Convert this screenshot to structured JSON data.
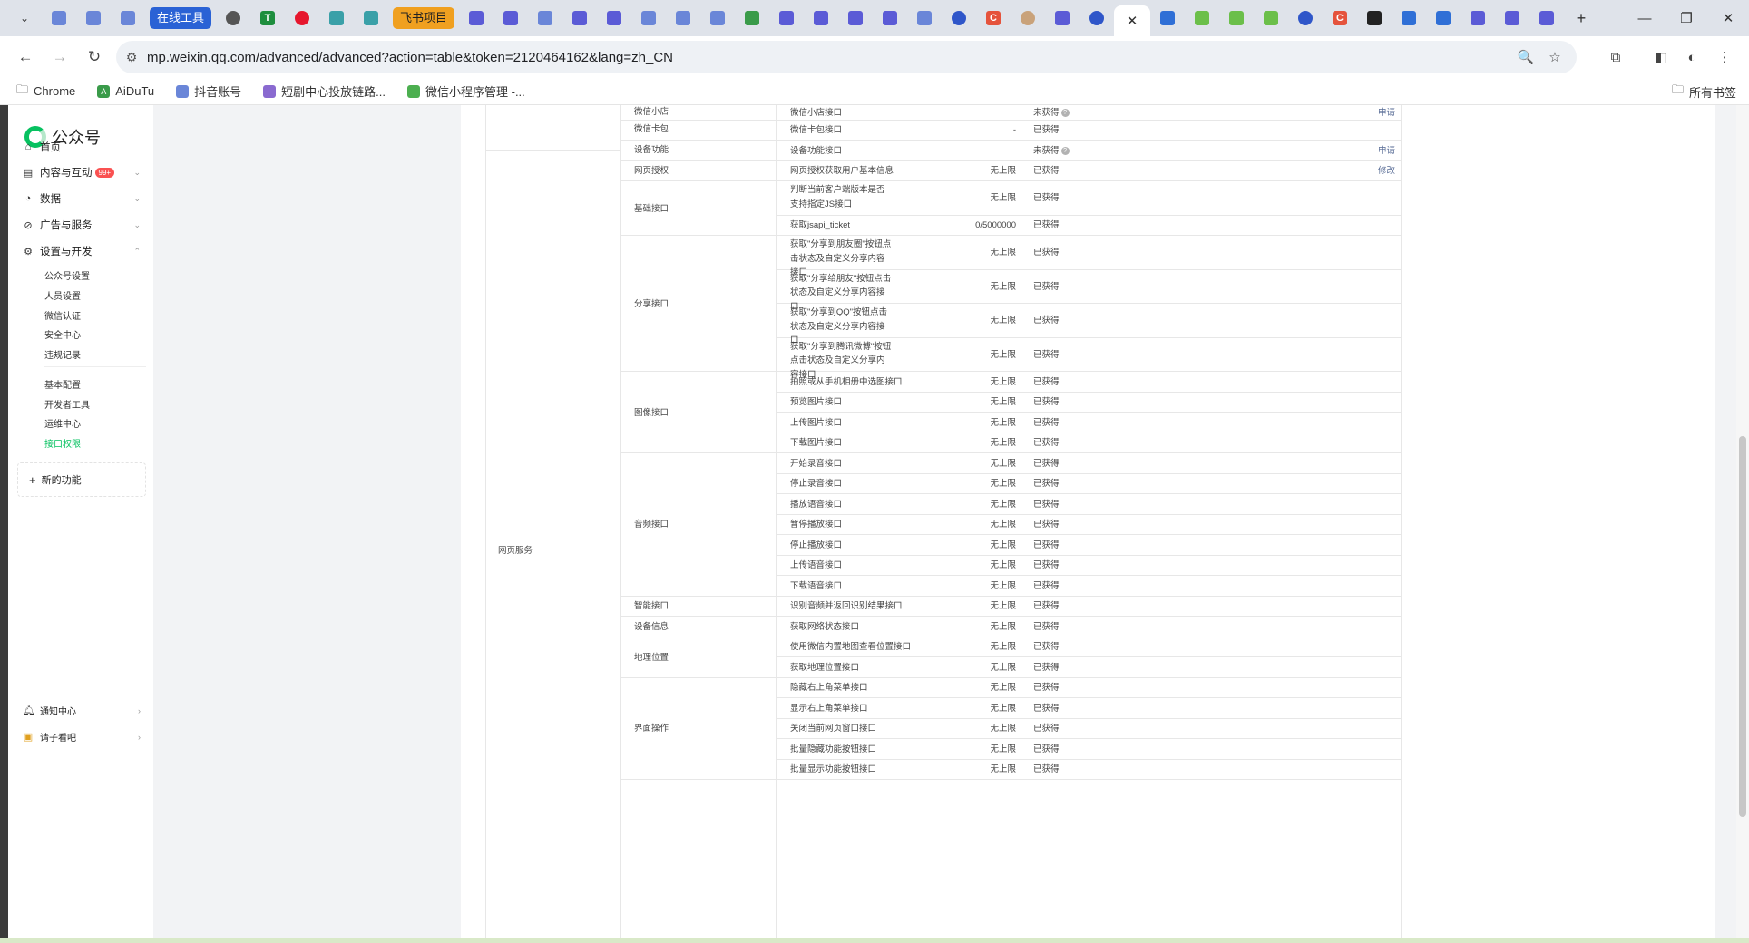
{
  "browser": {
    "tabs": {
      "pill_online_tools": "在线工具",
      "pill_feishu_project": "飞书项目",
      "new_tab_symbol": "+",
      "close_symbol": "✕"
    },
    "window": {
      "minimize": "—",
      "maximize": "❐",
      "close": "✕"
    },
    "url": "mp.weixin.qq.com/advanced/advanced?action=table&token=2120464162&lang=zh_CN",
    "bookmarks": [
      "Chrome",
      "AiDuTu",
      "抖音账号",
      "短剧中心投放链路...",
      "微信小程序管理 -..."
    ],
    "all_bookmarks": "所有书签"
  },
  "sidebar": {
    "brand": "公众号",
    "menu": [
      {
        "label": "首页",
        "icon": "home-icon"
      },
      {
        "label": "内容与互动",
        "icon": "document-icon",
        "badge": "99+"
      },
      {
        "label": "数据",
        "icon": "chart-icon"
      },
      {
        "label": "广告与服务",
        "icon": "compass-icon"
      },
      {
        "label": "设置与开发",
        "icon": "gear-icon"
      }
    ],
    "sub_settings": [
      "公众号设置",
      "人员设置",
      "微信认证",
      "安全中心",
      "违规记录"
    ],
    "sub_dev": [
      "基本配置",
      "开发者工具",
      "运维中心",
      "接口权限"
    ],
    "new_function": "新的功能",
    "bottom": [
      {
        "label": "通知中心",
        "icon": "bell-icon"
      },
      {
        "label": "请子看吧",
        "icon": "tv-icon"
      }
    ]
  },
  "table": {
    "group_label": "网页服务",
    "top_rows": [
      {
        "category": "微信小店",
        "name": "微信小店接口",
        "limit": "",
        "status": "未获得",
        "help": true,
        "op": "申请"
      },
      {
        "category": "微信卡包",
        "name": "微信卡包接口",
        "limit": "-",
        "status": "已获得",
        "help": false,
        "op": ""
      },
      {
        "category": "设备功能",
        "name": "设备功能接口",
        "limit": "",
        "status": "未获得",
        "help": true,
        "op": "申请"
      }
    ],
    "categories": [
      "网页授权",
      "基础接口",
      "分享接口",
      "图像接口",
      "音频接口",
      "智能接口",
      "设备信息",
      "地理位置",
      "界面操作"
    ],
    "rows": [
      {
        "name": "网页授权获取用户基本信息",
        "limit": "无上限",
        "status": "已获得",
        "op": "修改"
      },
      {
        "name": "判断当前客户端版本是否支持指定JS接口",
        "limit": "无上限",
        "status": "已获得",
        "op": ""
      },
      {
        "name": "获取jsapi_ticket",
        "limit": "0/5000000",
        "status": "已获得",
        "op": ""
      },
      {
        "name": "获取\"分享到朋友圈\"按钮点击状态及自定义分享内容接口",
        "limit": "无上限",
        "status": "已获得",
        "op": ""
      },
      {
        "name": "获取\"分享给朋友\"按钮点击状态及自定义分享内容接口",
        "limit": "无上限",
        "status": "已获得",
        "op": ""
      },
      {
        "name": "获取\"分享到QQ\"按钮点击状态及自定义分享内容接口",
        "limit": "无上限",
        "status": "已获得",
        "op": ""
      },
      {
        "name": "获取\"分享到腾讯微博\"按钮点击状态及自定义分享内容接口",
        "limit": "无上限",
        "status": "已获得",
        "op": ""
      },
      {
        "name": "拍照或从手机相册中选图接口",
        "limit": "无上限",
        "status": "已获得",
        "op": ""
      },
      {
        "name": "预览图片接口",
        "limit": "无上限",
        "status": "已获得",
        "op": ""
      },
      {
        "name": "上传图片接口",
        "limit": "无上限",
        "status": "已获得",
        "op": ""
      },
      {
        "name": "下载图片接口",
        "limit": "无上限",
        "status": "已获得",
        "op": ""
      },
      {
        "name": "开始录音接口",
        "limit": "无上限",
        "status": "已获得",
        "op": ""
      },
      {
        "name": "停止录音接口",
        "limit": "无上限",
        "status": "已获得",
        "op": ""
      },
      {
        "name": "播放语音接口",
        "limit": "无上限",
        "status": "已获得",
        "op": ""
      },
      {
        "name": "暂停播放接口",
        "limit": "无上限",
        "status": "已获得",
        "op": ""
      },
      {
        "name": "停止播放接口",
        "limit": "无上限",
        "status": "已获得",
        "op": ""
      },
      {
        "name": "上传语音接口",
        "limit": "无上限",
        "status": "已获得",
        "op": ""
      },
      {
        "name": "下载语音接口",
        "limit": "无上限",
        "status": "已获得",
        "op": ""
      },
      {
        "name": "识别音频并返回识别结果接口",
        "limit": "无上限",
        "status": "已获得",
        "op": ""
      },
      {
        "name": "获取网络状态接口",
        "limit": "无上限",
        "status": "已获得",
        "op": ""
      },
      {
        "name": "使用微信内置地图查看位置接口",
        "limit": "无上限",
        "status": "已获得",
        "op": ""
      },
      {
        "name": "获取地理位置接口",
        "limit": "无上限",
        "status": "已获得",
        "op": ""
      },
      {
        "name": "隐藏右上角菜单接口",
        "limit": "无上限",
        "status": "已获得",
        "op": ""
      },
      {
        "name": "显示右上角菜单接口",
        "limit": "无上限",
        "status": "已获得",
        "op": ""
      },
      {
        "name": "关闭当前网页窗口接口",
        "limit": "无上限",
        "status": "已获得",
        "op": ""
      },
      {
        "name": "批量隐藏功能按钮接口",
        "limit": "无上限",
        "status": "已获得",
        "op": ""
      },
      {
        "name": "批量显示功能按钮接口",
        "limit": "无上限",
        "status": "已获得",
        "op": ""
      }
    ]
  }
}
